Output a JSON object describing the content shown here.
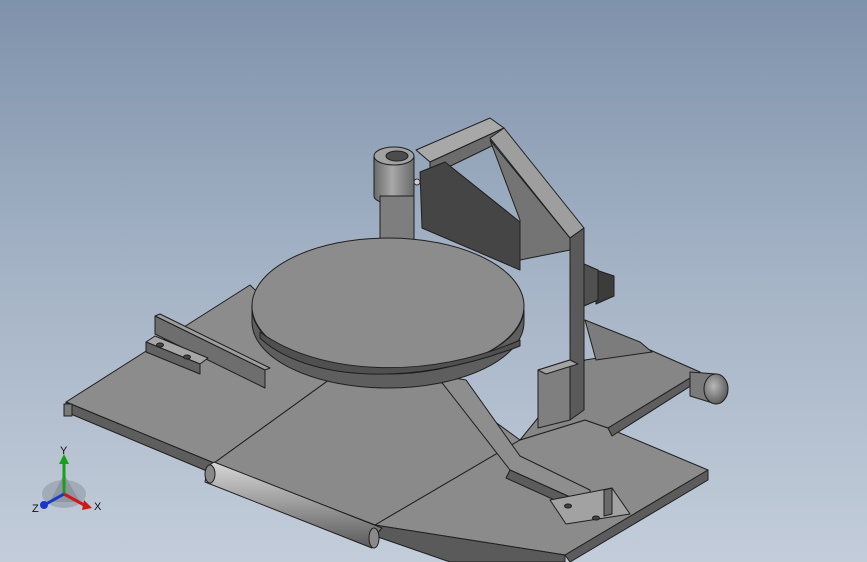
{
  "viewport": {
    "background_top": "#7f92ab",
    "background_bottom": "#c3cdda"
  },
  "model": {
    "base_color": "#8a8a8a",
    "shade_color": "#5c5c5c",
    "light_color": "#b0b0b0",
    "edge_color": "#1f1f1f"
  },
  "triad": {
    "x_label": "X",
    "y_label": "Y",
    "z_label": "Z",
    "x_color": "#d01818",
    "y_color": "#18a018",
    "z_color": "#1838c8"
  }
}
